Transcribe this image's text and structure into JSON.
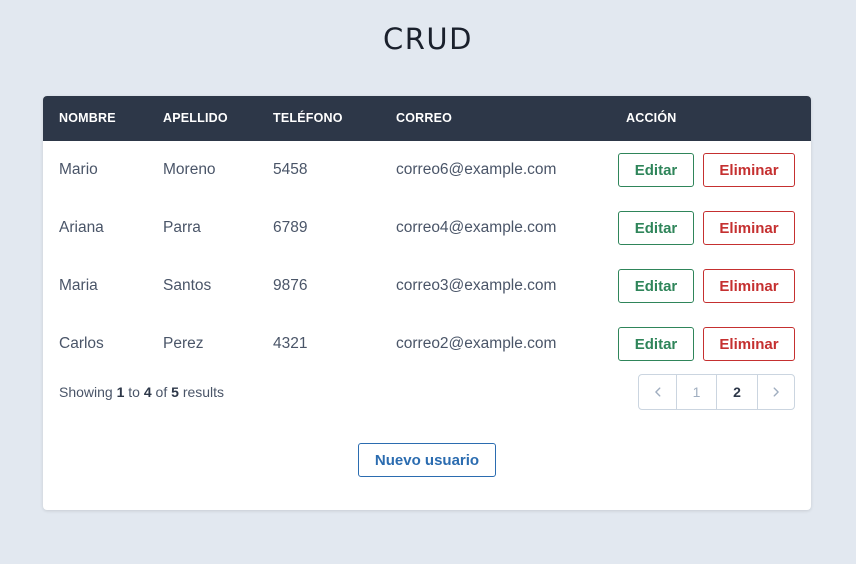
{
  "page": {
    "title": "CRUD"
  },
  "table": {
    "headers": [
      "NOMBRE",
      "APELLIDO",
      "TELÉFONO",
      "CORREO",
      "ACCIÓN"
    ],
    "rows": [
      {
        "nombre": "Mario",
        "apellido": "Moreno",
        "telefono": "5458",
        "correo": "correo6@example.com",
        "edit_label": "Editar",
        "delete_label": "Eliminar"
      },
      {
        "nombre": "Ariana",
        "apellido": "Parra",
        "telefono": "6789",
        "correo": "correo4@example.com",
        "edit_label": "Editar",
        "delete_label": "Eliminar"
      },
      {
        "nombre": "Maria",
        "apellido": "Santos",
        "telefono": "9876",
        "correo": "correo3@example.com",
        "edit_label": "Editar",
        "delete_label": "Eliminar"
      },
      {
        "nombre": "Carlos",
        "apellido": "Perez",
        "telefono": "4321",
        "correo": "correo2@example.com",
        "edit_label": "Editar",
        "delete_label": "Eliminar"
      }
    ]
  },
  "pagination": {
    "showing_prefix": "Showing",
    "from": "1",
    "to_word": "to",
    "to": "4",
    "of_word": "of",
    "total": "5",
    "results_word": "results",
    "pages": [
      "1",
      "2"
    ],
    "current_page": "2",
    "prev_icon": "chevron-left-icon",
    "next_icon": "chevron-right-icon"
  },
  "actions": {
    "new_user_label": "Nuevo usuario"
  },
  "colors": {
    "background": "#e2e8f0",
    "header": "#2d3748",
    "edit": "#2f855a",
    "delete": "#c53030",
    "primary": "#2b6cb0"
  }
}
